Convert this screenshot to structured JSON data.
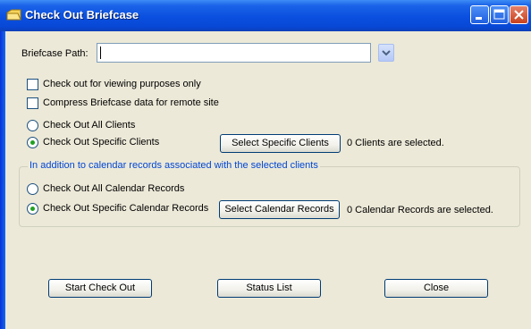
{
  "window": {
    "title": "Check Out Briefcase",
    "icons": {
      "app": "briefcase-icon",
      "minimize": "minimize-icon",
      "maximize": "maximize-icon",
      "close": "close-icon"
    },
    "colors": {
      "titlebar": "#0a4fdf",
      "client": "#ece9d8",
      "close_button": "#c9411d"
    }
  },
  "form": {
    "path_label": "Briefcase Path:",
    "path_value": "",
    "options": {
      "view_only": {
        "label": "Check out for viewing purposes only",
        "checked": false
      },
      "compress": {
        "label": "Compress Briefcase data for remote site",
        "checked": false
      }
    },
    "clients": {
      "all_label": "Check Out All Clients",
      "specific_label": "Check Out Specific Clients",
      "selected": "specific",
      "select_button": "Select Specific Clients",
      "status": "0 Clients are selected."
    },
    "calendar": {
      "group_title": "In addition to calendar records associated with the selected clients",
      "all_label": "Check Out All Calendar Records",
      "specific_label": "Check Out Specific Calendar Records",
      "selected": "specific",
      "select_button": "Select Calendar Records",
      "status": "0 Calendar Records are selected."
    }
  },
  "buttons": {
    "start": "Start Check Out",
    "status_list": "Status List",
    "close": "Close"
  }
}
